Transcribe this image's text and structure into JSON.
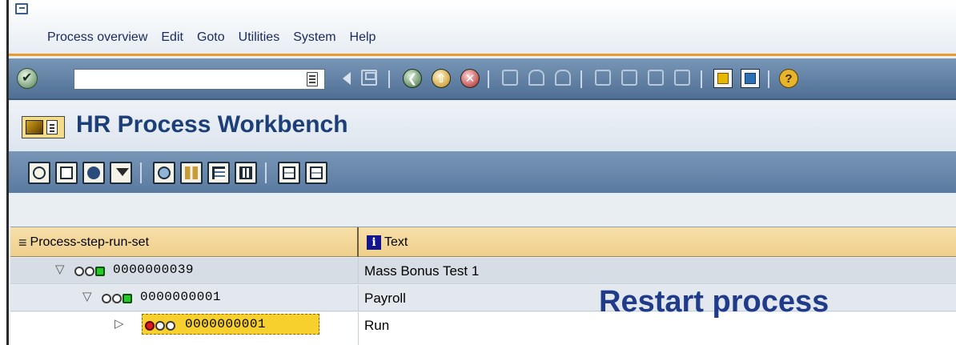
{
  "menu": {
    "items": [
      {
        "label": "Process overview"
      },
      {
        "label": "Edit"
      },
      {
        "label": "Goto"
      },
      {
        "label": "Utilities"
      },
      {
        "label": "System"
      },
      {
        "label": "Help"
      }
    ]
  },
  "toolbar": {
    "command_field_value": "",
    "icons": [
      "enter-check-icon",
      "command-dropdown-icon",
      "back-arrow-icon",
      "save-icon",
      "back-icon",
      "exit-icon",
      "cancel-icon",
      "print-icon",
      "find-icon",
      "find-next-icon",
      "first-page-icon",
      "previous-page-icon",
      "next-page-icon",
      "last-page-icon",
      "new-session-icon",
      "create-shortcut-icon",
      "help-icon"
    ]
  },
  "title": {
    "text": "HR Process Workbench"
  },
  "app_toolbar": {
    "icons": [
      "execute-clock-icon",
      "new-document-icon",
      "refresh-icon",
      "filter-icon",
      "search-icon",
      "persons-icon",
      "tree-layout-icon",
      "table-icon",
      "expand-icon",
      "collapse-icon"
    ]
  },
  "tree": {
    "columns": [
      "Process-step-run-set",
      "Text"
    ],
    "rows": [
      {
        "id": "0000000039",
        "text": "Mass Bonus Test 1",
        "status": "green",
        "expanded": true,
        "level": 0
      },
      {
        "id": "0000000001",
        "text": "Payroll",
        "status": "green",
        "expanded": true,
        "level": 1
      },
      {
        "id": "0000000001",
        "text": "Run",
        "status": "red",
        "expanded": false,
        "level": 2,
        "selected": true
      }
    ]
  },
  "annotation": {
    "text": "Restart process"
  },
  "colors": {
    "title": "#1d3f77",
    "annotation": "#1f3b8a",
    "selection": "#f7d02d",
    "toolbar": "#6585ab",
    "menu_accent": "#e89a2c"
  }
}
